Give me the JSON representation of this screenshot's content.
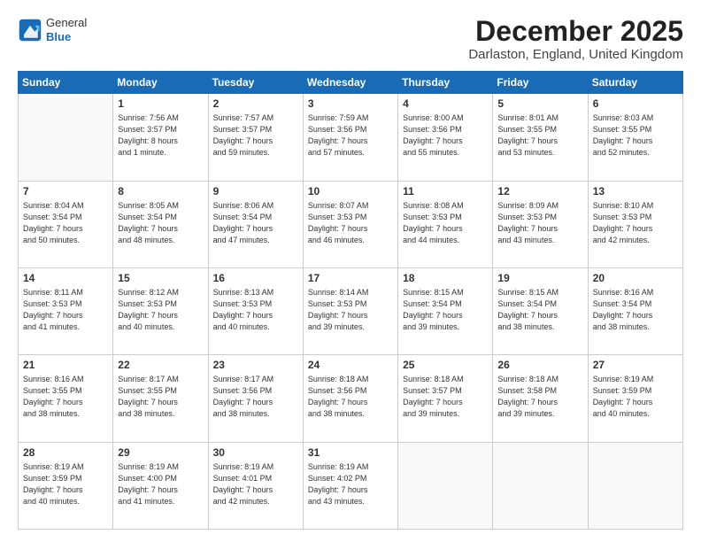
{
  "header": {
    "logo_general": "General",
    "logo_blue": "Blue",
    "month_title": "December 2025",
    "subtitle": "Darlaston, England, United Kingdom"
  },
  "days_of_week": [
    "Sunday",
    "Monday",
    "Tuesday",
    "Wednesday",
    "Thursday",
    "Friday",
    "Saturday"
  ],
  "weeks": [
    [
      {
        "day": "",
        "info": ""
      },
      {
        "day": "1",
        "info": "Sunrise: 7:56 AM\nSunset: 3:57 PM\nDaylight: 8 hours\nand 1 minute."
      },
      {
        "day": "2",
        "info": "Sunrise: 7:57 AM\nSunset: 3:57 PM\nDaylight: 7 hours\nand 59 minutes."
      },
      {
        "day": "3",
        "info": "Sunrise: 7:59 AM\nSunset: 3:56 PM\nDaylight: 7 hours\nand 57 minutes."
      },
      {
        "day": "4",
        "info": "Sunrise: 8:00 AM\nSunset: 3:56 PM\nDaylight: 7 hours\nand 55 minutes."
      },
      {
        "day": "5",
        "info": "Sunrise: 8:01 AM\nSunset: 3:55 PM\nDaylight: 7 hours\nand 53 minutes."
      },
      {
        "day": "6",
        "info": "Sunrise: 8:03 AM\nSunset: 3:55 PM\nDaylight: 7 hours\nand 52 minutes."
      }
    ],
    [
      {
        "day": "7",
        "info": "Sunrise: 8:04 AM\nSunset: 3:54 PM\nDaylight: 7 hours\nand 50 minutes."
      },
      {
        "day": "8",
        "info": "Sunrise: 8:05 AM\nSunset: 3:54 PM\nDaylight: 7 hours\nand 48 minutes."
      },
      {
        "day": "9",
        "info": "Sunrise: 8:06 AM\nSunset: 3:54 PM\nDaylight: 7 hours\nand 47 minutes."
      },
      {
        "day": "10",
        "info": "Sunrise: 8:07 AM\nSunset: 3:53 PM\nDaylight: 7 hours\nand 46 minutes."
      },
      {
        "day": "11",
        "info": "Sunrise: 8:08 AM\nSunset: 3:53 PM\nDaylight: 7 hours\nand 44 minutes."
      },
      {
        "day": "12",
        "info": "Sunrise: 8:09 AM\nSunset: 3:53 PM\nDaylight: 7 hours\nand 43 minutes."
      },
      {
        "day": "13",
        "info": "Sunrise: 8:10 AM\nSunset: 3:53 PM\nDaylight: 7 hours\nand 42 minutes."
      }
    ],
    [
      {
        "day": "14",
        "info": "Sunrise: 8:11 AM\nSunset: 3:53 PM\nDaylight: 7 hours\nand 41 minutes."
      },
      {
        "day": "15",
        "info": "Sunrise: 8:12 AM\nSunset: 3:53 PM\nDaylight: 7 hours\nand 40 minutes."
      },
      {
        "day": "16",
        "info": "Sunrise: 8:13 AM\nSunset: 3:53 PM\nDaylight: 7 hours\nand 40 minutes."
      },
      {
        "day": "17",
        "info": "Sunrise: 8:14 AM\nSunset: 3:53 PM\nDaylight: 7 hours\nand 39 minutes."
      },
      {
        "day": "18",
        "info": "Sunrise: 8:15 AM\nSunset: 3:54 PM\nDaylight: 7 hours\nand 39 minutes."
      },
      {
        "day": "19",
        "info": "Sunrise: 8:15 AM\nSunset: 3:54 PM\nDaylight: 7 hours\nand 38 minutes."
      },
      {
        "day": "20",
        "info": "Sunrise: 8:16 AM\nSunset: 3:54 PM\nDaylight: 7 hours\nand 38 minutes."
      }
    ],
    [
      {
        "day": "21",
        "info": "Sunrise: 8:16 AM\nSunset: 3:55 PM\nDaylight: 7 hours\nand 38 minutes."
      },
      {
        "day": "22",
        "info": "Sunrise: 8:17 AM\nSunset: 3:55 PM\nDaylight: 7 hours\nand 38 minutes."
      },
      {
        "day": "23",
        "info": "Sunrise: 8:17 AM\nSunset: 3:56 PM\nDaylight: 7 hours\nand 38 minutes."
      },
      {
        "day": "24",
        "info": "Sunrise: 8:18 AM\nSunset: 3:56 PM\nDaylight: 7 hours\nand 38 minutes."
      },
      {
        "day": "25",
        "info": "Sunrise: 8:18 AM\nSunset: 3:57 PM\nDaylight: 7 hours\nand 39 minutes."
      },
      {
        "day": "26",
        "info": "Sunrise: 8:18 AM\nSunset: 3:58 PM\nDaylight: 7 hours\nand 39 minutes."
      },
      {
        "day": "27",
        "info": "Sunrise: 8:19 AM\nSunset: 3:59 PM\nDaylight: 7 hours\nand 40 minutes."
      }
    ],
    [
      {
        "day": "28",
        "info": "Sunrise: 8:19 AM\nSunset: 3:59 PM\nDaylight: 7 hours\nand 40 minutes."
      },
      {
        "day": "29",
        "info": "Sunrise: 8:19 AM\nSunset: 4:00 PM\nDaylight: 7 hours\nand 41 minutes."
      },
      {
        "day": "30",
        "info": "Sunrise: 8:19 AM\nSunset: 4:01 PM\nDaylight: 7 hours\nand 42 minutes."
      },
      {
        "day": "31",
        "info": "Sunrise: 8:19 AM\nSunset: 4:02 PM\nDaylight: 7 hours\nand 43 minutes."
      },
      {
        "day": "",
        "info": ""
      },
      {
        "day": "",
        "info": ""
      },
      {
        "day": "",
        "info": ""
      }
    ]
  ]
}
